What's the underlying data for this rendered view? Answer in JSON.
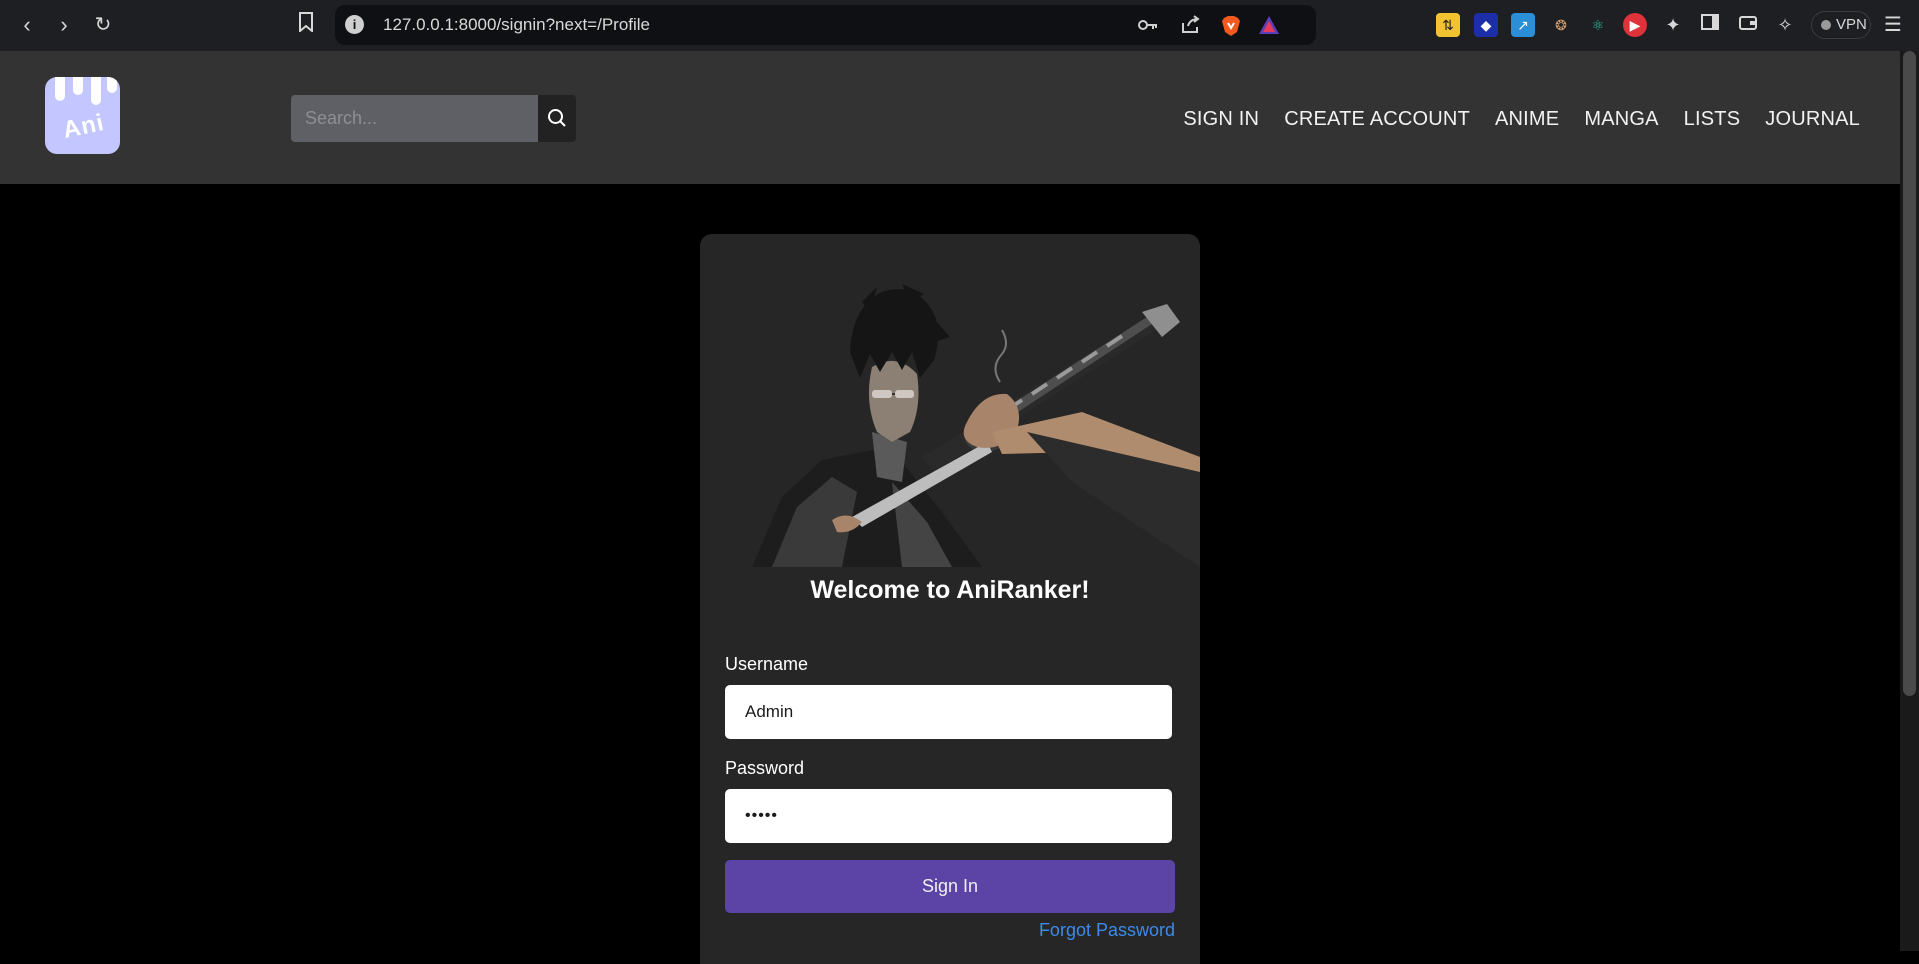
{
  "browser": {
    "url": "127.0.0.1:8000/signin?next=/Profile",
    "vpn_label": "VPN"
  },
  "header": {
    "logo_text": "Ani",
    "search_placeholder": "Search...",
    "nav": [
      "SIGN IN",
      "CREATE ACCOUNT",
      "ANIME",
      "MANGA",
      "LISTS",
      "JOURNAL"
    ]
  },
  "card": {
    "welcome": "Welcome to AniRanker!",
    "username_label": "Username",
    "username_value": "Admin",
    "password_label": "Password",
    "password_value": "•••••",
    "signin_label": "Sign In",
    "forgot_label": "Forgot Password"
  },
  "colors": {
    "header_bg": "#333333",
    "card_bg": "#262626",
    "button": "#5b44a6",
    "link": "#3d8be8",
    "logo_bg": "#c3c6ff"
  },
  "icons": [
    "back-icon",
    "forward-icon",
    "reload-icon",
    "bookmark-icon",
    "info-icon",
    "key-icon",
    "share-icon",
    "brave-icon",
    "triangle-icon",
    "search-icon",
    "menu-icon"
  ]
}
